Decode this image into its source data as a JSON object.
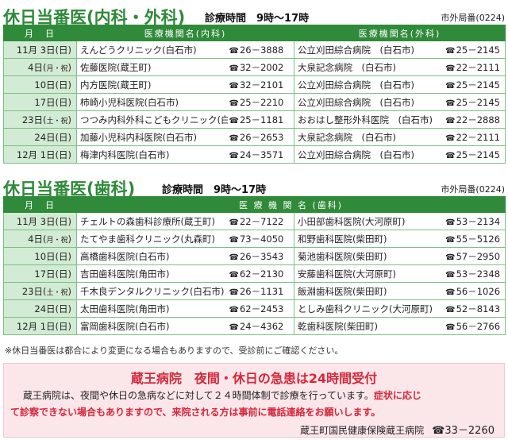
{
  "medical": {
    "title": "休日当番医(内科・外科)",
    "hours_label": "診療時間　9時～17時",
    "area_code": "市外局番(0224)",
    "headers": {
      "date": "月　日",
      "internal": "医療機関名(内科)",
      "surgery": "医療機関名(外科)"
    },
    "rows": [
      {
        "date": "11月 3日(日)",
        "date_mark": "",
        "internal": "えんどうクリニック(白石市)",
        "internal_phone": "26－3888",
        "surgery": "公立刈田綜合病院　(白石市)",
        "surgery_phone": "25－2145"
      },
      {
        "date": "4日(",
        "date_mark": "月・祝",
        "internal": "佐藤医院(蔵王町)",
        "internal_phone": "32－2002",
        "surgery": "大泉記念病院　(白石市)",
        "surgery_phone": "22－2111"
      },
      {
        "date": "10日(日)",
        "date_mark": "",
        "internal": "内方医院(蔵王町)",
        "internal_phone": "32－2101",
        "surgery": "公立刈田綜合病院　(白石市)",
        "surgery_phone": "25－2145"
      },
      {
        "date": "17日(日)",
        "date_mark": "",
        "internal": "柿崎小児科医院(白石市)",
        "internal_phone": "25－2210",
        "surgery": "公立刈田綜合病院　(白石市)",
        "surgery_phone": "25－2145"
      },
      {
        "date": "23日(",
        "date_mark": "土・祝",
        "internal": "つつみ内科外科こどもクリニック(白石市)",
        "internal_phone": "25－1181",
        "surgery": "おおはし整形外科医院　(白石市)",
        "surgery_phone": "22－2888"
      },
      {
        "date": "24日(日)",
        "date_mark": "",
        "internal": "加藤小児科内科医院(白石市)",
        "internal_phone": "26－2653",
        "surgery": "大泉記念病院　(白石市)",
        "surgery_phone": "22－2111"
      },
      {
        "date": "12月 1日(日)",
        "date_mark": "",
        "internal": "梅津内科医院(白石市)",
        "internal_phone": "24－3571",
        "surgery": "公立刈田綜合病院　(白石市)",
        "surgery_phone": "25－2145"
      }
    ]
  },
  "dental": {
    "title": "休日当番医(歯科)",
    "hours_label": "診療時間　9時～17時",
    "area_code": "市外局番(0224)",
    "headers": {
      "date": "月　日",
      "clinics": "医 療 機 関 名 (歯科)"
    },
    "rows": [
      {
        "date": "11月 3日(日)",
        "date_mark": "",
        "a": "チェルトの森歯科診療所(蔵王町)",
        "a_phone": "22－7122",
        "b": "小田部歯科医院(大河原町)",
        "b_phone": "53－2134"
      },
      {
        "date": "4日(",
        "date_mark": "月・祝",
        "a": "たてやま歯科クリニック(丸森町)",
        "a_phone": "73－4050",
        "b": "和野歯科医院(柴田町)",
        "b_phone": "55－5126"
      },
      {
        "date": "10日(日)",
        "date_mark": "",
        "a": "高橋歯科医院(白石市)",
        "a_phone": "26－3543",
        "b": "菊池歯科医院(柴田町)",
        "b_phone": "57－2950"
      },
      {
        "date": "17日(日)",
        "date_mark": "",
        "a": "吉田歯科医院(角田市)",
        "a_phone": "62－2130",
        "b": "安藤歯科医院(大河原町)",
        "b_phone": "53－2348"
      },
      {
        "date": "23日(",
        "date_mark": "土・祝",
        "a": "千木良デンタルクリニック(白石市)",
        "a_phone": "26－1131",
        "b": "飯淵歯科医院(柴田町)",
        "b_phone": "56－1026"
      },
      {
        "date": "24日(日)",
        "date_mark": "",
        "a": "太田歯科医院(角田市)",
        "a_phone": "62－2453",
        "b": "としみ歯科クリニック(大河原町)",
        "b_phone": "52－8143"
      },
      {
        "date": "12月 1日(日)",
        "date_mark": "",
        "a": "富岡歯科医院(白石市)",
        "a_phone": "24－4362",
        "b": "乾歯科医院(柴田町)",
        "b_phone": "56－2766"
      }
    ]
  },
  "note": "※休日当番医は都合により変更になる場合もありますので、受診前にご確認ください。",
  "emergency": {
    "title": "蔵王病院　夜間・休日の急患は24時間受付",
    "line1": "蔵王病院は、夜間や休日の急病などに対して２４時間体制で診療を行っています。",
    "line1_red": "症状に応じ",
    "line2": "て診察できない場合もありますので、来院される方は事前に電話連絡をお願いします。",
    "footer_org": "蔵王町国民健康保険蔵王病院",
    "footer_phone": "☎33－2260"
  },
  "phone_icon": "phone-icon",
  "tel_glyph": "☎",
  "colors": {
    "green": "#2f8a3a",
    "light_green": "#d2ebd4",
    "red": "#d4283a",
    "pink": "#fbe6ea"
  }
}
